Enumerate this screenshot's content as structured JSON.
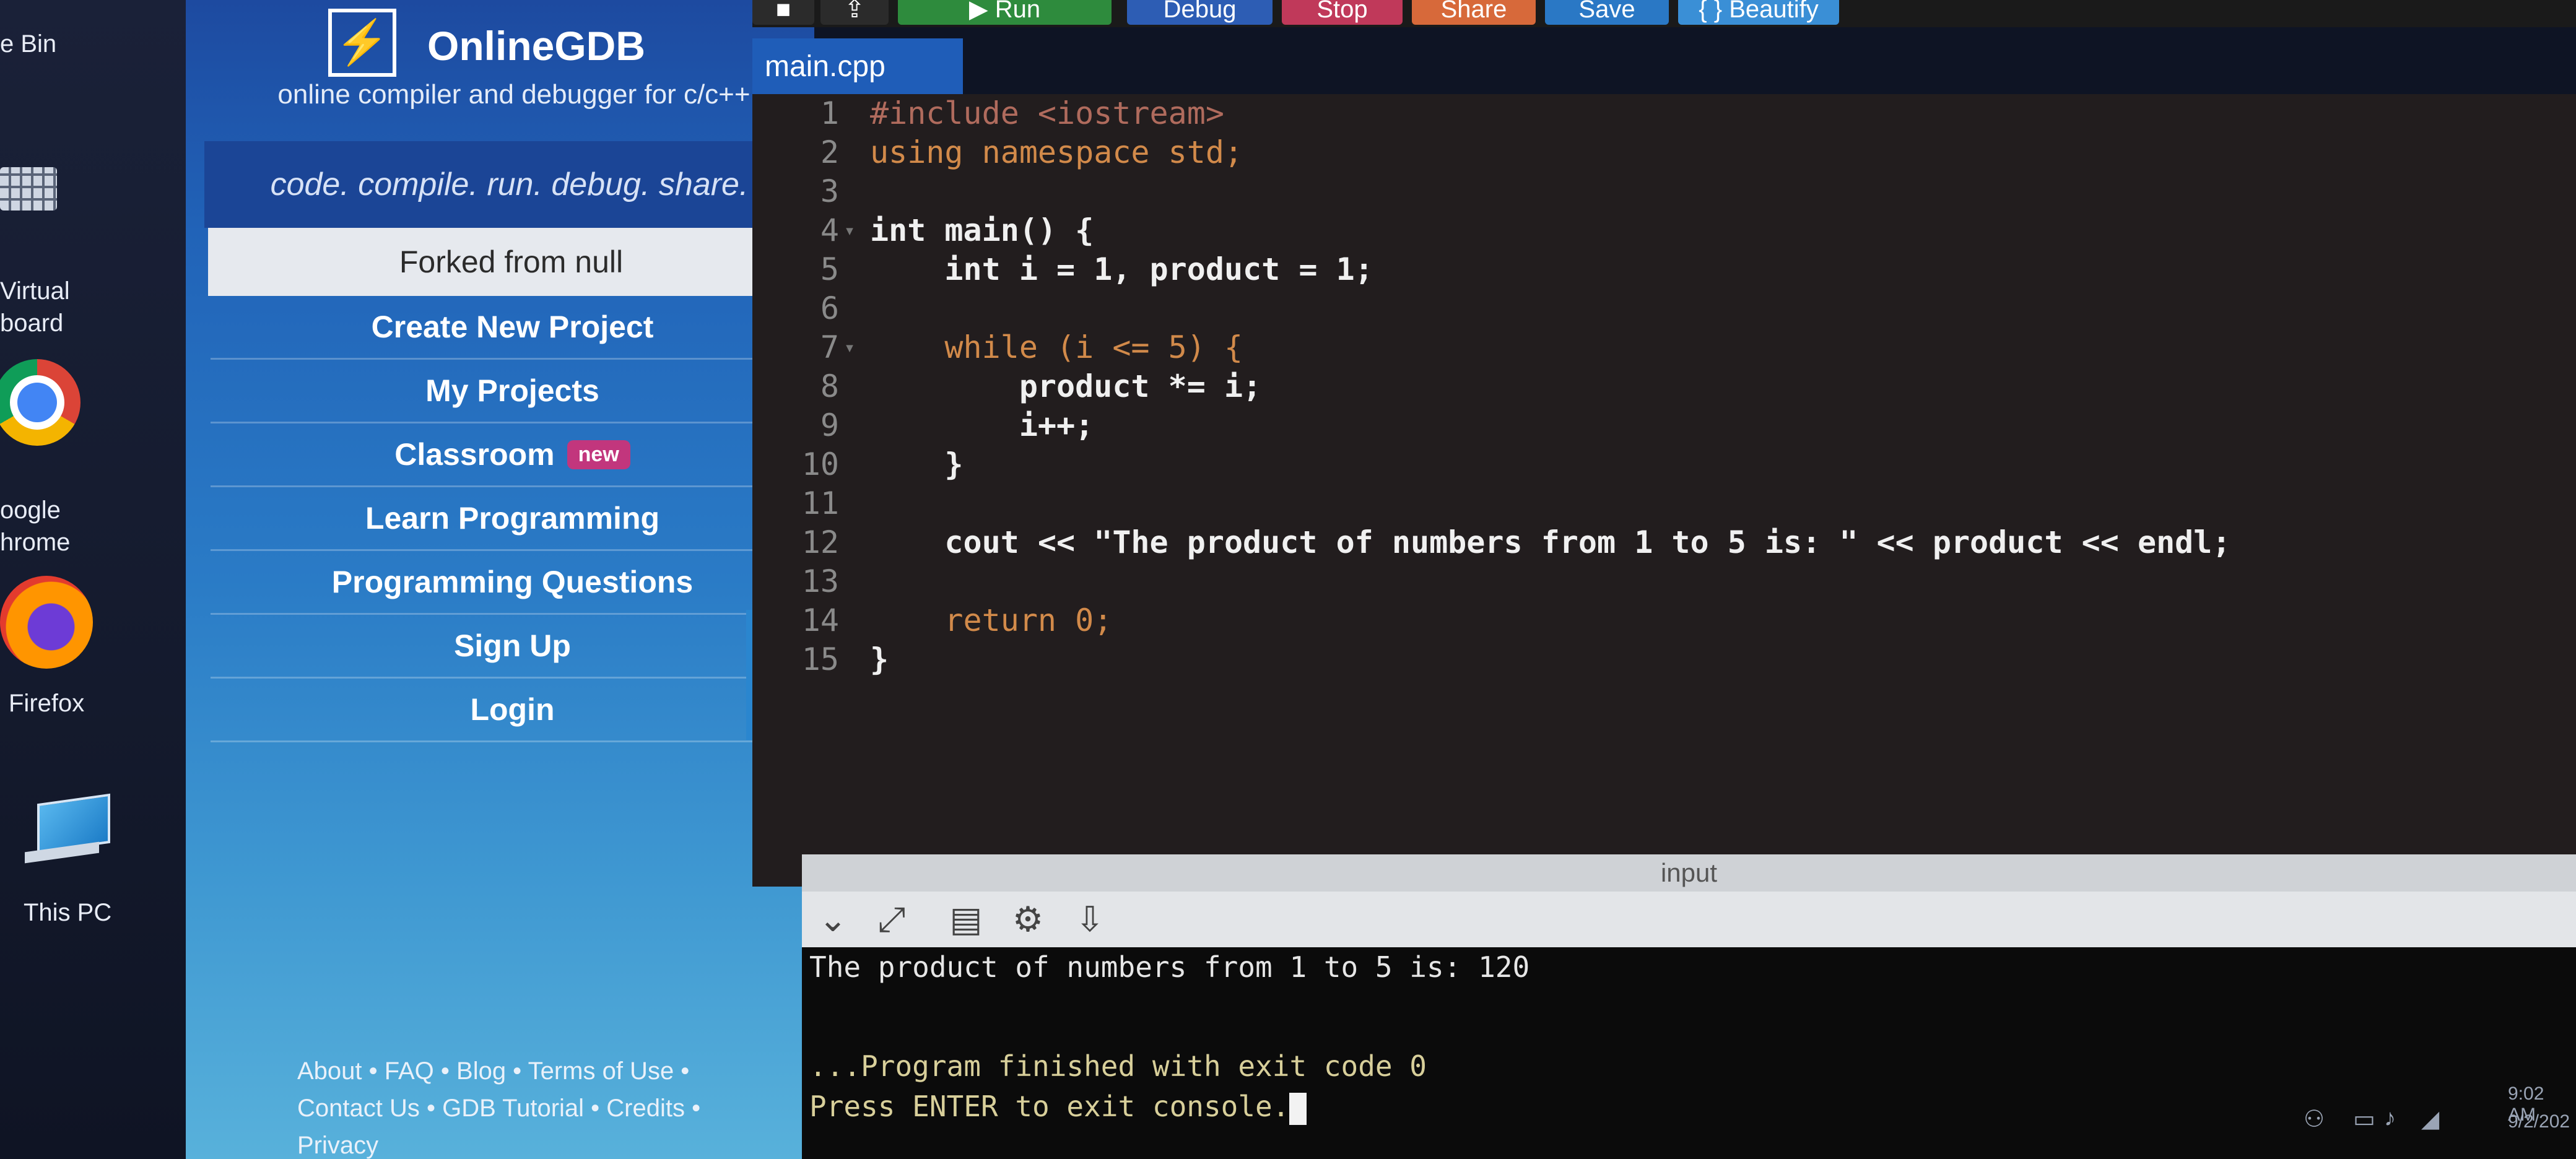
{
  "desktop": {
    "icons": [
      {
        "label": "e Bin",
        "icon": "recycle-bin-icon"
      },
      {
        "label": "Virtual\nboard",
        "icon": "keyboard-icon"
      },
      {
        "label": "oogle\nhrome",
        "icon": "chrome-icon"
      },
      {
        "label": "Firefox",
        "icon": "firefox-icon"
      },
      {
        "label": "This PC",
        "icon": "this-pc-icon"
      }
    ]
  },
  "brand": {
    "name": "OnlineGDB",
    "logo_glyph": "⚡",
    "tagline": "online compiler and debugger for c/c++",
    "motto": "code. compile. run. debug. share."
  },
  "sidebar": {
    "forked": "Forked from null",
    "items": [
      {
        "label": "Create New Project"
      },
      {
        "label": "My Projects"
      },
      {
        "label": "Classroom",
        "badge": "new"
      },
      {
        "label": "Learn Programming"
      },
      {
        "label": "Programming Questions"
      },
      {
        "label": "Sign Up"
      },
      {
        "label": "Login"
      }
    ],
    "footer_line1": "About • FAQ • Blog • Terms of Use •",
    "footer_line2": "Contact Us • GDB Tutorial • Credits •",
    "footer_line3": "Privacy",
    "collapse_glyph": "❮",
    "colors": {
      "dark": "#1d4aa0",
      "light": "#58b1db",
      "badge": "#c2367d"
    }
  },
  "toolbar": {
    "run": "▶ Run",
    "debug": "Debug",
    "stop": "Stop",
    "share": "Share",
    "save": "Save",
    "beautify": "{ } Beautify",
    "colors": {
      "run": "#2e8b3d",
      "debug": "#2d5db4",
      "stop": "#c0395a",
      "share": "#d7693a",
      "save": "#2a78c5"
    }
  },
  "editor": {
    "file_tab": "main.cpp",
    "lines": [
      {
        "n": "1",
        "code": "#include <iostream>"
      },
      {
        "n": "2",
        "code": "using namespace std;"
      },
      {
        "n": "3",
        "code": ""
      },
      {
        "n": "4",
        "code": "int main() {"
      },
      {
        "n": "5",
        "code": "    int i = 1, product = 1;"
      },
      {
        "n": "6",
        "code": ""
      },
      {
        "n": "7",
        "code": "    while (i <= 5) {"
      },
      {
        "n": "8",
        "code": "        product *= i;"
      },
      {
        "n": "9",
        "code": "        i++;"
      },
      {
        "n": "10",
        "code": "    }"
      },
      {
        "n": "11",
        "code": ""
      },
      {
        "n": "12",
        "code": "    cout << \"The product of numbers from 1 to 5 is: \" << product << endl;"
      },
      {
        "n": "13",
        "code": ""
      },
      {
        "n": "14",
        "code": "    return 0;"
      },
      {
        "n": "15",
        "code": "}"
      }
    ]
  },
  "console": {
    "input_label": "input",
    "output_line1": "The product of numbers from 1 to 5 is: 120",
    "output_line2": "...Program finished with exit code 0",
    "output_line3": "Press ENTER to exit console."
  },
  "tray": {
    "time": "9:02 AM",
    "date": "9/2/202"
  }
}
